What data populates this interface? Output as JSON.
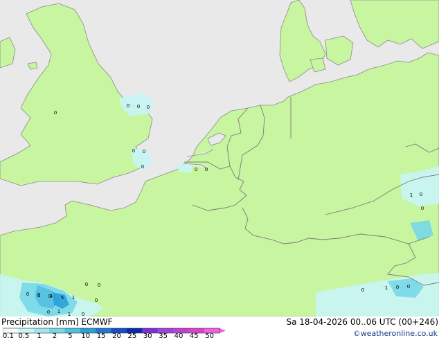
{
  "footer": {
    "title_left": "Precipitation [mm] ECMWF",
    "title_right": "Sa 18-04-2026 00..06 UTC (00+246)",
    "credit": "©weatheronline.co.uk"
  },
  "legend": {
    "ticks": [
      "0.1",
      "0.5",
      "1",
      "2",
      "5",
      "10",
      "15",
      "20",
      "25",
      "30",
      "35",
      "40",
      "45",
      "50"
    ],
    "colors": [
      "#f5fdfd",
      "#c8f5f5",
      "#a0e8ee",
      "#78d8e8",
      "#50c0e0",
      "#2aa0d8",
      "#1e78d0",
      "#1450c8",
      "#0a28b0",
      "#7a30d8",
      "#a040e0",
      "#c040d8",
      "#e040c8",
      "#f060e0"
    ]
  },
  "map": {
    "colors": {
      "sea": "#e9e9e9",
      "land": "#c8f5a0",
      "border": "#7a7a7a",
      "coast": "#8a8a8a"
    },
    "labels": [
      {
        "text": "0"
      },
      {
        "text": "0"
      },
      {
        "text": "0"
      },
      {
        "text": "0"
      },
      {
        "text": "0"
      },
      {
        "text": "0"
      },
      {
        "text": "0"
      },
      {
        "text": "0"
      },
      {
        "text": "0"
      },
      {
        "text": "0"
      },
      {
        "text": "0"
      },
      {
        "text": "0"
      },
      {
        "text": "0"
      },
      {
        "text": "0"
      },
      {
        "text": "0"
      },
      {
        "text": "1"
      },
      {
        "text": "4"
      },
      {
        "text": "5"
      },
      {
        "text": "1"
      },
      {
        "text": "0"
      },
      {
        "text": "1"
      },
      {
        "text": "1"
      },
      {
        "text": "0"
      },
      {
        "text": "0"
      },
      {
        "text": "1"
      },
      {
        "text": "0"
      },
      {
        "text": "0"
      },
      {
        "text": "1"
      },
      {
        "text": "0"
      },
      {
        "text": "0"
      }
    ]
  }
}
